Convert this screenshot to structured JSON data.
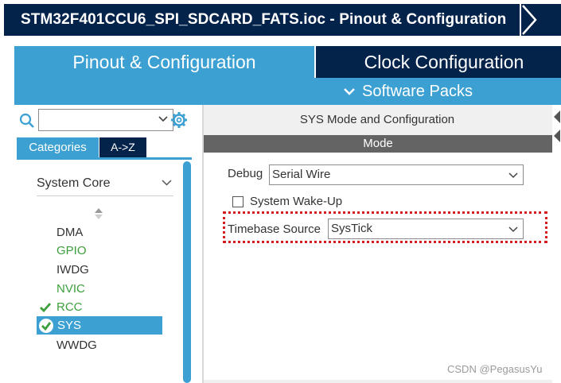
{
  "window": {
    "title": "STM32F401CCU6_SPI_SDCARD_FATS.ioc - Pinout & Configuration"
  },
  "tabs": {
    "pinout": "Pinout & Configuration",
    "clock": "Clock Configuration",
    "software_packs": "Software Packs"
  },
  "sidebar": {
    "search": {
      "value": "",
      "placeholder": ""
    },
    "view_tabs": {
      "categories": "Categories",
      "az": "A->Z"
    },
    "category": "System Core",
    "items": [
      {
        "label": "DMA",
        "state": "normal"
      },
      {
        "label": "GPIO",
        "state": "configured"
      },
      {
        "label": "IWDG",
        "state": "normal"
      },
      {
        "label": "NVIC",
        "state": "configured"
      },
      {
        "label": "RCC",
        "state": "checked"
      },
      {
        "label": "SYS",
        "state": "selected"
      },
      {
        "label": "WWDG",
        "state": "normal"
      }
    ]
  },
  "panel": {
    "title": "SYS Mode and Configuration",
    "section": "Mode",
    "debug": {
      "label": "Debug",
      "value": "Serial Wire"
    },
    "wakeup": {
      "label": "System Wake-Up",
      "checked": false
    },
    "timebase": {
      "label": "Timebase Source",
      "value": "SysTick"
    }
  },
  "watermark": "CSDN @PegasusYu",
  "colors": {
    "navy": "#03234b",
    "accent_blue": "#3ca0d2",
    "green": "#3c9f3c",
    "mode_bar": "#646464",
    "highlight": "#d21e1e"
  }
}
